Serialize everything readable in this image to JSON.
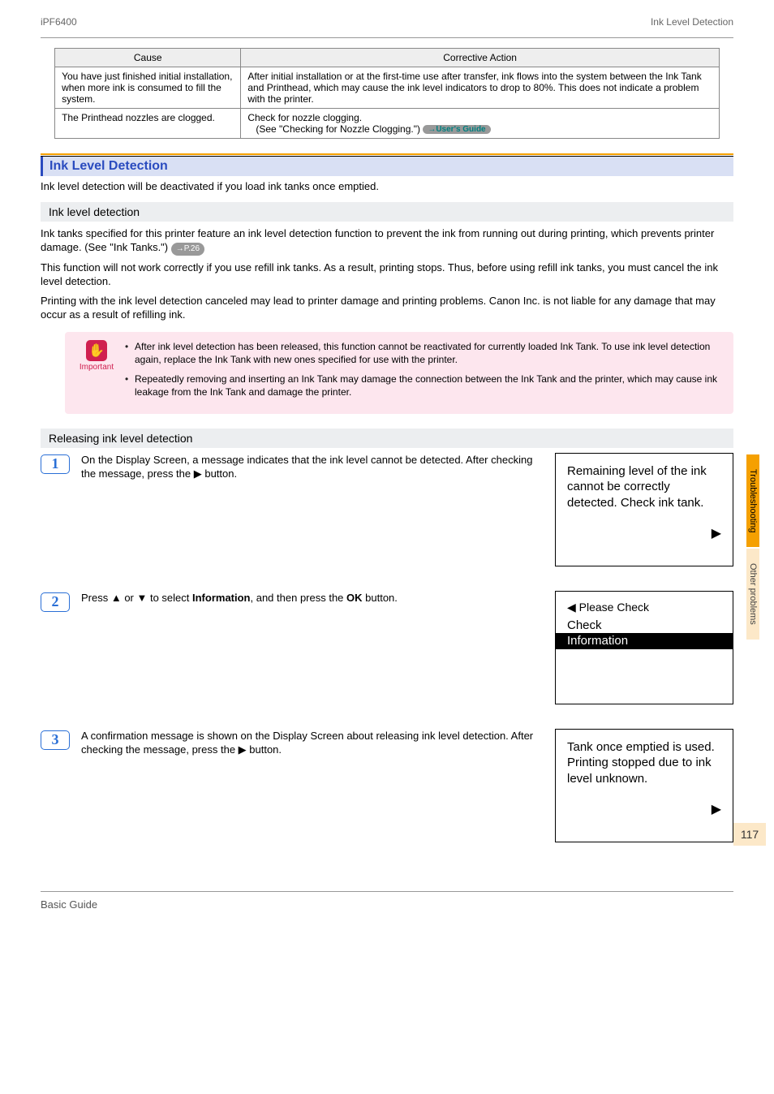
{
  "header": {
    "left": "iPF6400",
    "right": "Ink Level Detection"
  },
  "table": {
    "head": {
      "cause": "Cause",
      "action": "Corrective Action"
    },
    "rows": [
      {
        "cause": "You have just finished initial installation, when more ink is consumed to fill the system.",
        "action": "After initial installation or at the first-time use after transfer, ink flows into the system between the Ink Tank and Printhead, which may cause the ink level indicators to drop to 80%. This does not indicate a problem with the printer."
      },
      {
        "cause": "The Printhead nozzles are clogged.",
        "action_pre": "Check for nozzle clogging.",
        "action_see_label": "(See \"Checking for Nozzle Clogging.\")",
        "action_link": "→User's Guide"
      }
    ]
  },
  "section": {
    "title": "Ink Level Detection",
    "intro": "Ink level detection will be deactivated if you load ink tanks once emptied."
  },
  "sub1": {
    "heading": "Ink level detection",
    "p1_a": "Ink tanks specified for this printer feature an ink level detection function to prevent the ink from running out during printing, which prevents printer damage.  (See \"Ink Tanks.\")",
    "p1_ref": "→P.26",
    "p2": "This function will not work correctly if you use refill ink tanks. As a result, printing stops. Thus, before using refill ink tanks, you must cancel the ink level detection.",
    "p3": "Printing with the ink level detection canceled may lead to printer damage and printing problems. Canon Inc. is not liable for any damage that may occur as a result of refilling ink."
  },
  "important": {
    "label": "Important",
    "items": [
      "After ink level detection has been released, this function cannot be reactivated for currently loaded Ink Tank. To use ink level detection again, replace the Ink Tank with new ones specified for use with the printer.",
      "Repeatedly removing and inserting an Ink Tank may damage the connection between the Ink Tank and the printer, which may cause ink leakage from the Ink Tank and damage the printer."
    ]
  },
  "sub2": {
    "heading": "Releasing ink level detection"
  },
  "steps": {
    "s1": {
      "num": "1",
      "text": "On the Display Screen, a message indicates that the ink level cannot be detected. After checking the message, press the ▶ button.",
      "screen_lines": "Remaining level of the ink cannot be correctly detected. Check ink tank.",
      "arrow": "▶"
    },
    "s2": {
      "num": "2",
      "text_a": "Press ▲ or ▼ to select ",
      "text_bold": "Information",
      "text_b": ", and then press the ",
      "text_bold2": "OK",
      "text_c": " button.",
      "screen_back": "◀ Please Check",
      "screen_opt1": "Check",
      "screen_opt2": "Information"
    },
    "s3": {
      "num": "3",
      "text": "A confirmation message is shown on the Display Screen about releasing ink level detection. After checking the message, press the ▶ button.",
      "screen_lines": "Tank once emptied is used. Printing stopped due to ink level unknown.",
      "arrow": "▶"
    }
  },
  "sidetabs": {
    "a": "Troubleshooting",
    "b": "Other problems"
  },
  "page_number": "117",
  "footer": "Basic Guide"
}
